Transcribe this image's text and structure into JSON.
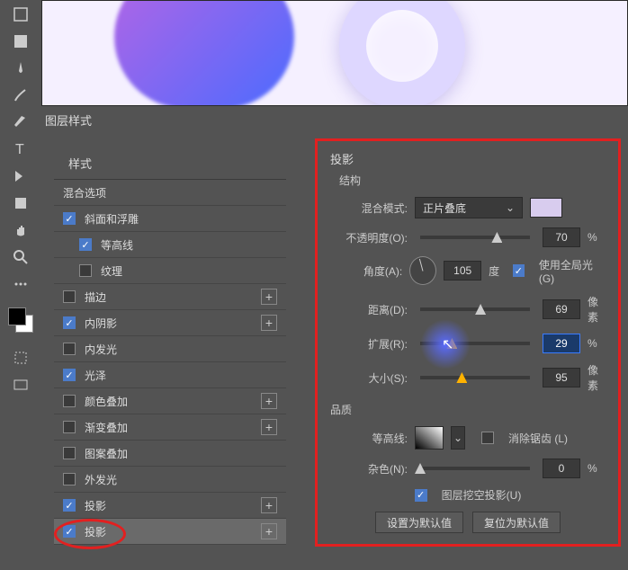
{
  "dialog_title": "图层样式",
  "styles_panel": {
    "header": "样式",
    "items": [
      {
        "label": "混合选项",
        "checked": null,
        "indent": false,
        "plus": false
      },
      {
        "label": "斜面和浮雕",
        "checked": true,
        "indent": false,
        "plus": false
      },
      {
        "label": "等高线",
        "checked": true,
        "indent": true,
        "plus": false
      },
      {
        "label": "纹理",
        "checked": false,
        "indent": true,
        "plus": false
      },
      {
        "label": "描边",
        "checked": false,
        "indent": false,
        "plus": true
      },
      {
        "label": "内阴影",
        "checked": true,
        "indent": false,
        "plus": true
      },
      {
        "label": "内发光",
        "checked": false,
        "indent": false,
        "plus": false
      },
      {
        "label": "光泽",
        "checked": true,
        "indent": false,
        "plus": false
      },
      {
        "label": "颜色叠加",
        "checked": false,
        "indent": false,
        "plus": true
      },
      {
        "label": "渐变叠加",
        "checked": false,
        "indent": false,
        "plus": true
      },
      {
        "label": "图案叠加",
        "checked": false,
        "indent": false,
        "plus": false
      },
      {
        "label": "外发光",
        "checked": false,
        "indent": false,
        "plus": false
      },
      {
        "label": "投影",
        "checked": true,
        "indent": false,
        "plus": true
      },
      {
        "label": "投影",
        "checked": true,
        "indent": false,
        "plus": true,
        "selected": true
      }
    ]
  },
  "right_panel": {
    "title": "投影",
    "structure": "结构",
    "blend_mode_label": "混合模式:",
    "blend_mode_value": "正片叠底",
    "opacity_label": "不透明度(O):",
    "opacity_value": "70",
    "opacity_unit": "%",
    "angle_label": "角度(A):",
    "angle_value": "105",
    "angle_unit": "度",
    "global_light": "使用全局光 (G)",
    "distance_label": "距离(D):",
    "distance_value": "69",
    "distance_unit": "像素",
    "spread_label": "扩展(R):",
    "spread_value": "29",
    "spread_unit": "%",
    "size_label": "大小(S):",
    "size_value": "95",
    "size_unit": "像素",
    "quality": "品质",
    "contour_label": "等高线:",
    "antialias": "消除锯齿 (L)",
    "noise_label": "杂色(N):",
    "noise_value": "0",
    "noise_unit": "%",
    "knockout": "图层挖空投影(U)",
    "set_default": "设置为默认值",
    "reset_default": "复位为默认值",
    "color_swatch": "#d8ccee"
  }
}
